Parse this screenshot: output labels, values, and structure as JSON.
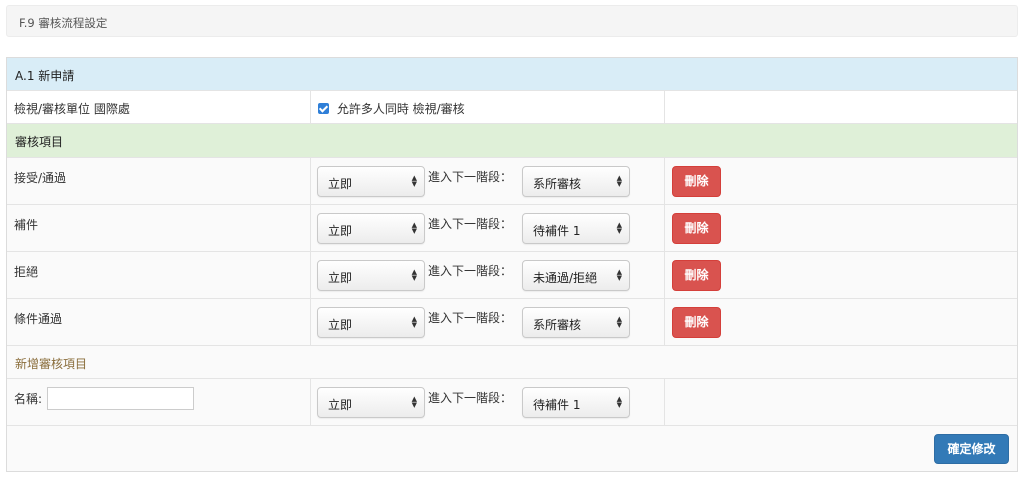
{
  "header": {
    "title": "F.9 審核流程設定"
  },
  "section": {
    "title": "A.1 新申請",
    "unit_label": "檢視/審核單位 國際處",
    "allow_label": "允許多人同時 檢視/審核"
  },
  "review": {
    "title": "審核項目",
    "next_label": "進入下一階段：",
    "delete_label": "刪除",
    "items": [
      {
        "name": "接受/通過",
        "timing": "立即",
        "next": "系所審核"
      },
      {
        "name": "補件",
        "timing": "立即",
        "next": "待補件 1"
      },
      {
        "name": "拒絕",
        "timing": "立即",
        "next": "未通過/拒絕"
      },
      {
        "name": "條件通過",
        "timing": "立即",
        "next": "系所審核"
      }
    ]
  },
  "add": {
    "title": "新增審核項目",
    "name_label": "名稱:",
    "name_value": "",
    "timing": "立即",
    "next": "待補件 1"
  },
  "footer": {
    "confirm_label": "確定修改"
  }
}
